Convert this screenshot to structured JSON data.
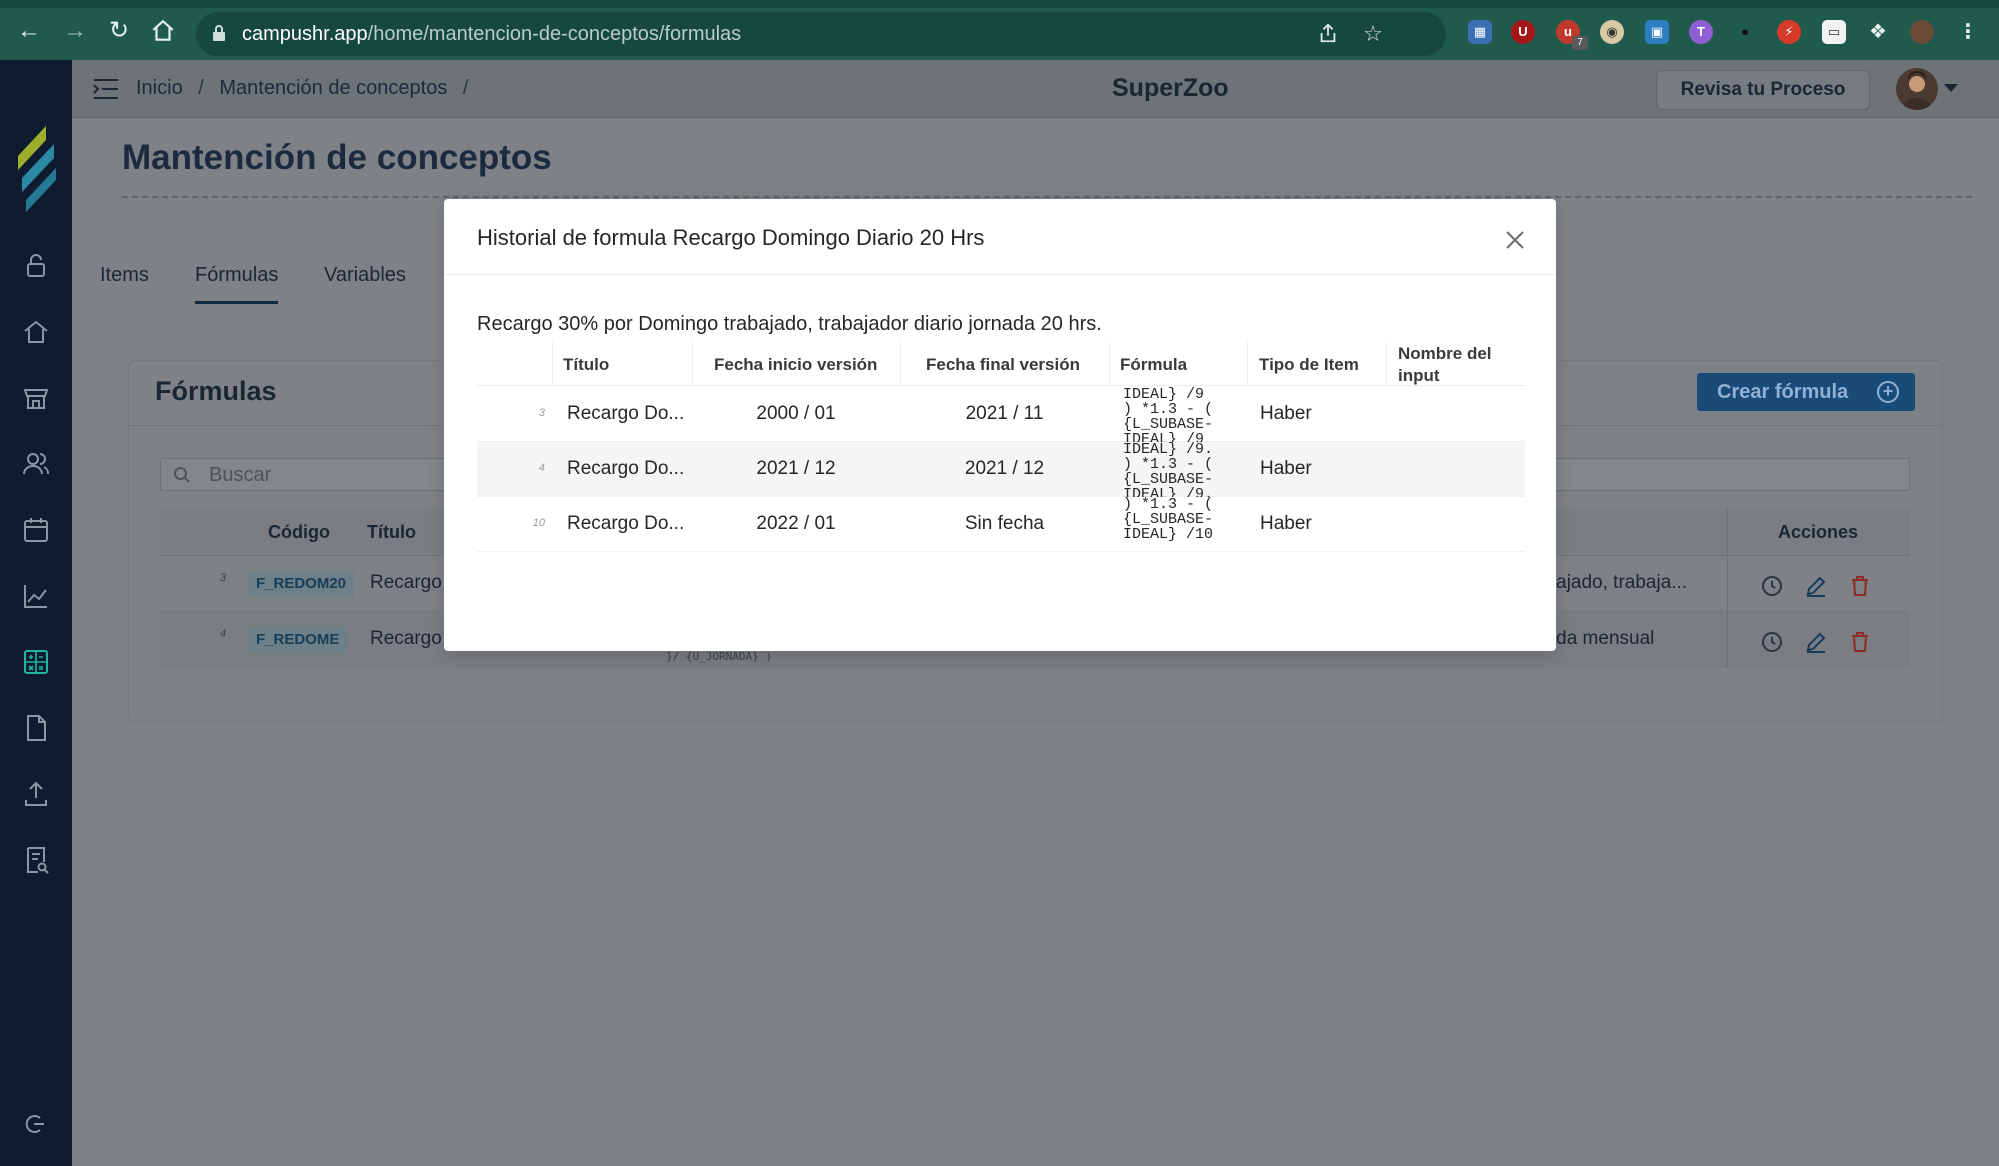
{
  "browser": {
    "url_host": "campushr.app",
    "url_path": "/home/mantencion-de-conceptos/formulas",
    "extension_badge": "7"
  },
  "topbar": {
    "breadcrumbs": [
      "Inicio",
      "/",
      "Mantención de conceptos",
      "/"
    ],
    "company": "SuperZoo",
    "revisa_button": "Revisa tu Proceso"
  },
  "page": {
    "title": "Mantención de conceptos",
    "tabs": [
      "Items",
      "Fórmulas",
      "Variables"
    ],
    "tabs_more": "···",
    "active_tab": "Fórmulas"
  },
  "card": {
    "title": "Fórmulas",
    "create_button": "Crear fórmula",
    "search_placeholder": "Buscar",
    "headers": {
      "code": "Código",
      "title": "Título",
      "actions": "Acciones"
    },
    "rows": [
      {
        "num": "3",
        "code": "F_REDOM20",
        "title": "Recargo",
        "desc": "abajado, trabaja..."
      },
      {
        "num": "4",
        "code": "F_REDOME",
        "title": "Recargo",
        "desc": "nada mensual",
        "formula_fragment": "}/ {U_JORNADA} )"
      }
    ]
  },
  "modal": {
    "title": "Historial de formula Recargo Domingo Diario 20 Hrs",
    "description": "Recargo 30% por Domingo trabajado, trabajador diario jornada 20 hrs.",
    "headers": {
      "title": "Título",
      "start": "Fecha inicio versión",
      "end": "Fecha final versión",
      "formula": "Fórmula",
      "item_type": "Tipo de Item",
      "input_name": "Nombre del input"
    },
    "rows": [
      {
        "num": "3",
        "title": "Recargo Do...",
        "start": "2000 / 01",
        "end": "2021 / 11",
        "formula": "IDEAL} /9\n) *1.3 - (\n{L_SUBASE-\nIDEAL} /9",
        "item_type": "Haber",
        "input_name": ""
      },
      {
        "num": "4",
        "title": "Recargo Do...",
        "start": "2021 / 12",
        "end": "2021 / 12",
        "formula": "IDEAL} /9.\n) *1.3 - (\n{L_SUBASE-\nIDEAL} /9.",
        "item_type": "Haber",
        "input_name": ""
      },
      {
        "num": "10",
        "title": "Recargo Do...",
        "start": "2022 / 01",
        "end": "Sin fecha",
        "formula": ") *1.3 - (\n{L_SUBASE-\nIDEAL} /10",
        "item_type": "Haber",
        "input_name": ""
      }
    ]
  },
  "colors": {
    "sidebar": "#0f1c2f",
    "chrome": "#1f5a4d",
    "accent_blue": "#1a4a78",
    "danger": "#c0392b"
  }
}
